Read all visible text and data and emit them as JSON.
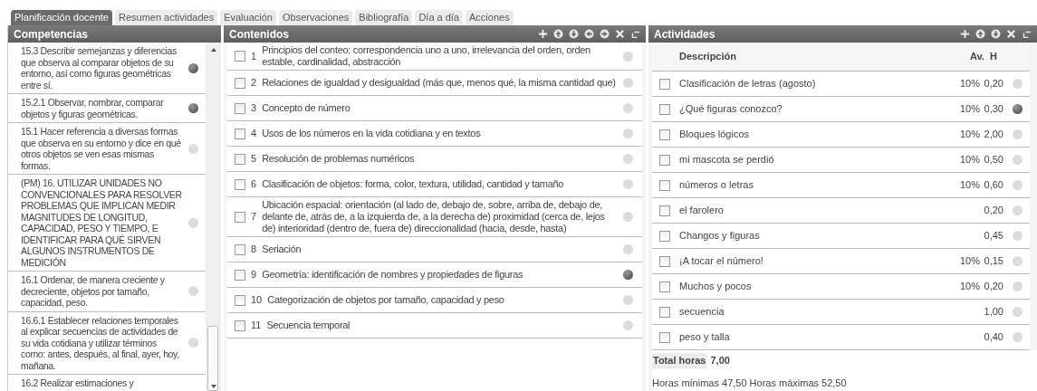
{
  "tabs": [
    {
      "label": "Planificación docente",
      "selected": true
    },
    {
      "label": "Resumen actividades",
      "selected": false
    },
    {
      "label": "Evaluación",
      "selected": false
    },
    {
      "label": "Observaciones",
      "selected": false
    },
    {
      "label": "Bibliografía",
      "selected": false
    },
    {
      "label": "Día a día",
      "selected": false
    },
    {
      "label": "Acciones",
      "selected": false
    }
  ],
  "competencias": {
    "title": "Competencias",
    "items": [
      {
        "text": "15.3 Describir semejanzas y diferencias que observa al comparar objetos de su entorno, así como figuras geométricas entre sí.",
        "active": true
      },
      {
        "text": "15.2.1 Observar, nombrar, comparar objetos y figuras geométricas.",
        "active": true
      },
      {
        "text": "15.1 Hacer referencia a diversas formas que observa en su entorno y dice en qué otros objetos se ven esas mismas formas.",
        "active": false
      },
      {
        "text": "(PM) 16. UTILIZAR UNIDADES NO CONVENCIONALES PARA RESOLVER PROBLEMAS QUE IMPLICAN MEDIR MAGNITUDES DE LONGITUD, CAPACIDAD, PESO Y TIEMPO, E IDENTIFICAR PARA QUÉ SIRVEN ALGUNOS INSTRUMENTOS DE MEDICIÓN",
        "active": false
      },
      {
        "text": "16.1 Ordenar, de manera creciente y decreciente, objetos por tamaño, capacidad, peso.",
        "active": false
      },
      {
        "text": "16.6.1 Establecer relaciones temporales al explicar secuencias de actividades de su vida cotidiana y utilizar términos como: antes, después, al final, ayer, hoy, mañana.",
        "active": false
      },
      {
        "text": "16.2 Realizar estimaciones y"
      }
    ]
  },
  "contenidos": {
    "title": "Contenidos",
    "items": [
      {
        "number": "1",
        "text": "Principios del conteo: correspondencia uno a uno, irrelevancia del orden, orden estable, cardinalidad, abstracción",
        "checked": false,
        "active": false
      },
      {
        "number": "2",
        "text": "Relaciones de igualdad y desigualdad (más que, menos qué, la misma cantidad que)",
        "checked": false,
        "active": false
      },
      {
        "number": "3",
        "text": "Concepto de número",
        "checked": false,
        "active": false
      },
      {
        "number": "4",
        "text": "Usos de los números en la vida cotidiana y en textos",
        "checked": false,
        "active": false
      },
      {
        "number": "5",
        "text": "Resolución de problemas numéricos",
        "checked": false,
        "active": false
      },
      {
        "number": "6",
        "text": "Clasificación de objetos: forma, color, textura, utilidad, cantidad y tamaño",
        "checked": false,
        "active": false
      },
      {
        "number": "7",
        "text": "Ubicación espacial: orientación (al lado de, debajo de, sobre, arriba de, debajo de, delante de, atrás de, a la izquierda de, a la derecha de) proximidad (cerca de, lejos de) interioridad (dentro de, fuera de) direccionalidad (hacia, desde, hasta)",
        "checked": false,
        "active": false
      },
      {
        "number": "8",
        "text": "Seriación",
        "checked": false,
        "active": false
      },
      {
        "number": "9",
        "text": "Geometría: identificación de nombres y propiedades de figuras",
        "checked": false,
        "active": true
      },
      {
        "number": "10",
        "text": "Categorización de objetos por tamaño, capacidad y peso",
        "checked": false,
        "active": false
      },
      {
        "number": "11",
        "text": "Secuencia temporal",
        "checked": false,
        "active": false
      }
    ]
  },
  "actividades": {
    "title": "Actividades",
    "columns": [
      "Descripción",
      "Av.",
      "H"
    ],
    "rows": [
      {
        "description": "Clasificación de letras (agosto)",
        "av": "10%",
        "h": "0,20",
        "checked": false,
        "active": false
      },
      {
        "description": "¿Qué figuras conozco?",
        "av": "10%",
        "h": "0,30",
        "checked": false,
        "active": true
      },
      {
        "description": "Bloques lógicos",
        "av": "10%",
        "h": "2,00",
        "checked": false,
        "active": false
      },
      {
        "description": "mi mascota se perdió",
        "av": "10%",
        "h": "0,50",
        "checked": false,
        "active": false
      },
      {
        "description": "números o letras",
        "av": "10%",
        "h": "0,60",
        "checked": false,
        "active": false
      },
      {
        "description": "el farolero",
        "h": "0,20",
        "checked": false,
        "active": false
      },
      {
        "description": "Changos y figuras",
        "h": "0,45",
        "checked": false,
        "active": false
      },
      {
        "description": "¡A tocar el número!",
        "av": "10%",
        "h": "0,15",
        "checked": false,
        "active": false
      },
      {
        "description": "Muchos y pocos",
        "av": "10%",
        "h": "0,20",
        "checked": false,
        "active": false
      },
      {
        "description": "secuencia",
        "h": "1,00",
        "checked": false,
        "active": false
      },
      {
        "description": "peso y talla",
        "h": "0,40",
        "checked": false,
        "active": false
      }
    ],
    "total_label": "Total horas",
    "total_value": "7,00",
    "summary": "Horas mínimas 47,50 Horas máximas 52,50"
  }
}
